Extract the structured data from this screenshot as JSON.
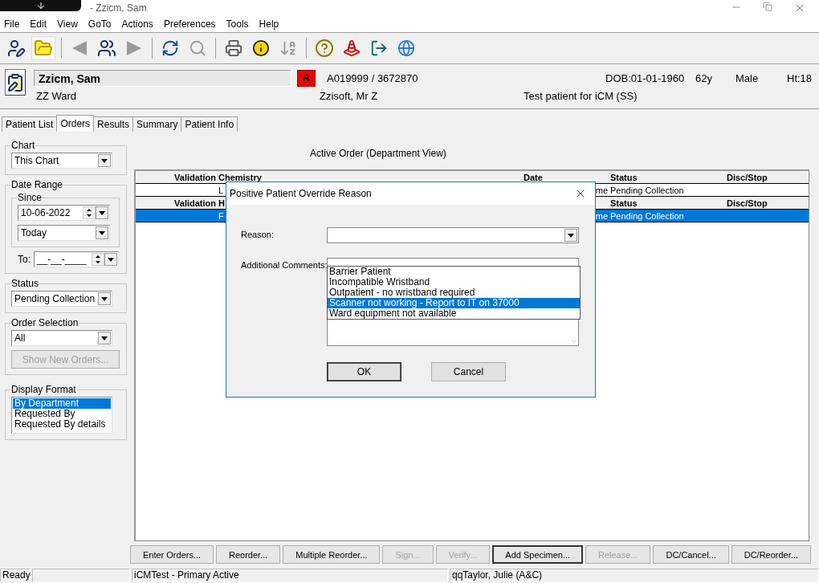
{
  "window": {
    "title": "- Zzicm, Sam"
  },
  "menu": [
    "File",
    "Edit",
    "View",
    "GoTo",
    "Actions",
    "Preferences",
    "Tools",
    "Help"
  ],
  "patient": {
    "name": "Zzicm, Sam",
    "ward": "ZZ Ward",
    "alert": "A",
    "ids": "A019999 / 3672870",
    "consultant": "Zzisoft, Mr Z",
    "dob": "DOB:01-01-1960",
    "age": "62y",
    "sex": "Male",
    "height": "Ht:18",
    "note": "Test patient for iCM (SS)"
  },
  "tabs": [
    {
      "label": "Patient List",
      "selected": false
    },
    {
      "label": "Orders",
      "selected": true
    },
    {
      "label": "Results",
      "selected": false
    },
    {
      "label": "Summary",
      "selected": false
    },
    {
      "label": "Patient Info",
      "selected": false
    }
  ],
  "filters": {
    "chart": {
      "legend": "Chart",
      "value": "This Chart"
    },
    "date_range": {
      "legend": "Date Range",
      "since_legend": "Since",
      "since_date": "10-06-2022",
      "since_preset": "Today",
      "to_label": "To:",
      "to_date": "__-__-____"
    },
    "status": {
      "legend": "Status",
      "value": "Pending Collection"
    },
    "order_selection": {
      "legend": "Order Selection",
      "value": "All",
      "button": "Show New Orders...",
      "button_disabled": true
    },
    "display_format": {
      "legend": "Display Format",
      "options": [
        {
          "label": "By Department",
          "selected": true
        },
        {
          "label": "Requested By",
          "selected": false
        },
        {
          "label": "Requested By details",
          "selected": false
        }
      ]
    }
  },
  "orders": {
    "title": "Active Order (Department View)",
    "sections": [
      {
        "headers": {
          "validation": "Validation",
          "test": "Chemistry",
          "date": "Date",
          "status": "Status",
          "disc_stop": "Disc/Stop"
        },
        "rows": [
          {
            "test": "L",
            "date": "me",
            "status": "Pending Collection",
            "selected": false
          }
        ]
      },
      {
        "headers": {
          "validation": "Validation",
          "test": "H",
          "status": "Status",
          "disc_stop": "Disc/Stop"
        },
        "rows": [
          {
            "test": "F",
            "date": "me",
            "status": "Pending Collection",
            "selected": true
          }
        ]
      }
    ]
  },
  "dialog": {
    "title": "Positive Patient Override Reason",
    "reason_label": "Reason:",
    "comments_label": "Additional Comments:",
    "options": [
      {
        "label": "Barrier Patient",
        "selected": false
      },
      {
        "label": "Incompatible Wristband",
        "selected": false
      },
      {
        "label": "Outpatient - no wristband required",
        "selected": false
      },
      {
        "label": "Scanner not working - Report to IT on 37000",
        "selected": true
      },
      {
        "label": "Ward equipment not available",
        "selected": false
      }
    ],
    "ok": "OK",
    "cancel": "Cancel"
  },
  "actions": [
    {
      "label": "Enter Orders...",
      "disabled": false,
      "focused": false
    },
    {
      "label": "Reorder...",
      "disabled": false,
      "focused": false
    },
    {
      "label": "Multiple Reorder...",
      "disabled": false,
      "focused": false
    },
    {
      "label": "Sign...",
      "disabled": true,
      "focused": false
    },
    {
      "label": "Verify...",
      "disabled": true,
      "focused": false
    },
    {
      "label": "Add Specimen...",
      "disabled": false,
      "focused": true
    },
    {
      "label": "Release...",
      "disabled": true,
      "focused": false
    },
    {
      "label": "DC/Cancel...",
      "disabled": false,
      "focused": false
    },
    {
      "label": "DC/Reorder...",
      "disabled": false,
      "focused": false
    }
  ],
  "status_bar": {
    "state": "Ready",
    "session": "iCMTest - Primary Active",
    "user": "qqTaylor, Julie  (A&C)"
  }
}
